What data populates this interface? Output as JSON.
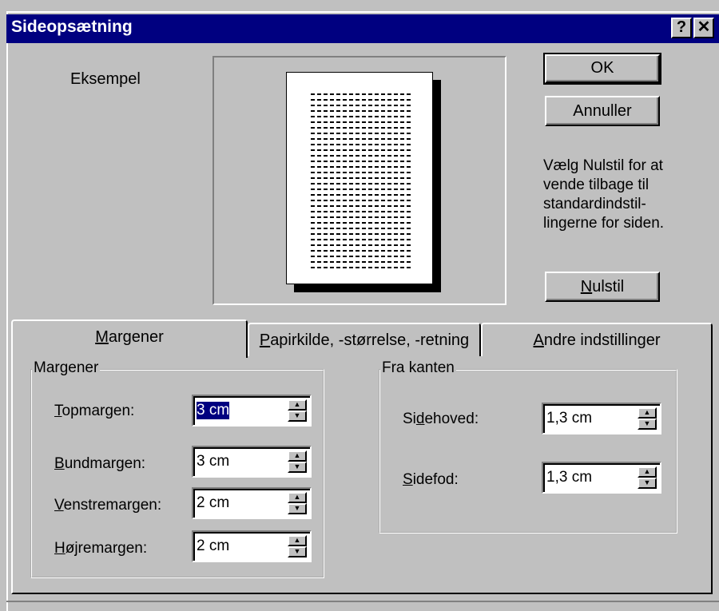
{
  "window": {
    "title": "Sideopsætning",
    "help_btn": "?",
    "close_btn": "✕"
  },
  "example_label": "Eksempel",
  "buttons": {
    "ok": "OK",
    "cancel": "Annuller",
    "reset_pre": "",
    "reset_u": "N",
    "reset_post": "ulstil"
  },
  "info_text": [
    "Vælg Nulstil for at",
    "vende tilbage til",
    "standardindstil-",
    "lingerne for siden."
  ],
  "tabs": [
    {
      "u": "M",
      "rest": "argener"
    },
    {
      "u": "P",
      "rest": "apirkilde, -størrelse, -retning"
    },
    {
      "u": "A",
      "rest": "ndre indstillinger"
    }
  ],
  "margins_group": {
    "label": "Margener",
    "fields": [
      {
        "pre": "",
        "u": "T",
        "post": "opmargen:",
        "value": "3 cm"
      },
      {
        "pre": "",
        "u": "B",
        "post": "undmargen:",
        "value": "3 cm"
      },
      {
        "pre": "",
        "u": "V",
        "post": "enstremargen:",
        "value": "2 cm"
      },
      {
        "pre": "",
        "u": "H",
        "post": "øjremargen:",
        "value": "2 cm"
      }
    ]
  },
  "edge_group": {
    "label": "Fra kanten",
    "fields": [
      {
        "pre": "Si",
        "u": "d",
        "post": "ehoved:",
        "value": "1,3 cm"
      },
      {
        "pre": "",
        "u": "S",
        "post": "idefod:",
        "value": "1,3 cm"
      }
    ]
  },
  "icons": {
    "spin_up": "▲",
    "spin_down": "▼"
  }
}
